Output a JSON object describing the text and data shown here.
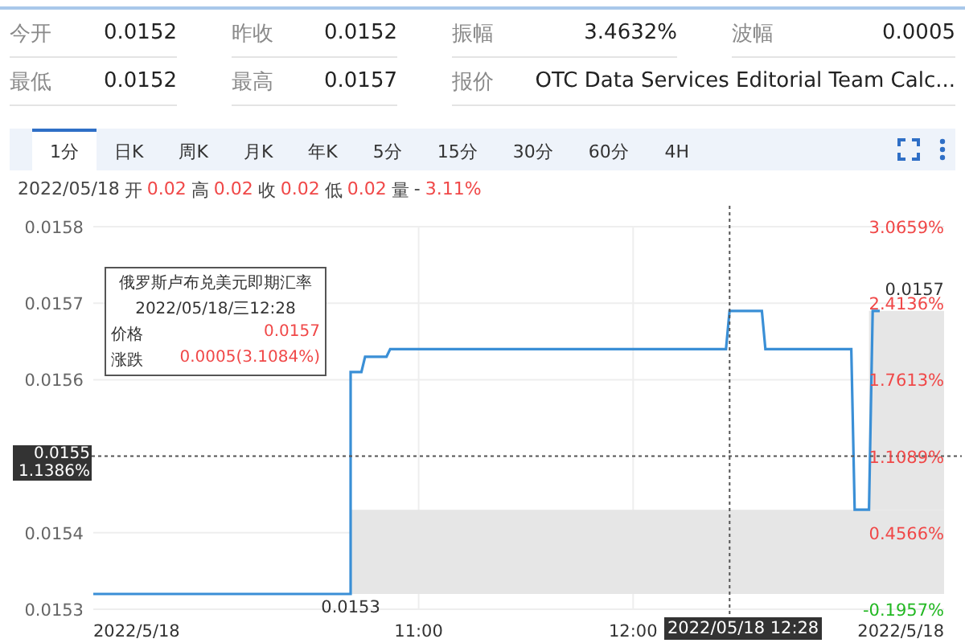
{
  "stats": [
    {
      "label": "今开",
      "value": "0.0152"
    },
    {
      "label": "昨收",
      "value": "0.0152"
    },
    {
      "label": "振幅",
      "value": "3.4632%"
    },
    {
      "label": "波幅",
      "value": "0.0005"
    },
    {
      "label": "最低",
      "value": "0.0152"
    },
    {
      "label": "最高",
      "value": "0.0157"
    },
    {
      "label": "报价",
      "value": "OTC Data Services Editorial Team Calc...",
      "wide": true
    }
  ],
  "tabs": [
    {
      "label": "1分",
      "selected": true
    },
    {
      "label": "日K",
      "selected": false
    },
    {
      "label": "周K",
      "selected": false
    },
    {
      "label": "月K",
      "selected": false
    },
    {
      "label": "年K",
      "selected": false
    },
    {
      "label": "5分",
      "selected": false
    },
    {
      "label": "15分",
      "selected": false
    },
    {
      "label": "30分",
      "selected": false
    },
    {
      "label": "60分",
      "selected": false
    },
    {
      "label": "4H",
      "selected": false
    }
  ],
  "quote_line": {
    "date": "2022/05/18",
    "fields": [
      {
        "label": "开",
        "value": "0.02"
      },
      {
        "label": "高",
        "value": "0.02"
      },
      {
        "label": "收",
        "value": "0.02"
      },
      {
        "label": "低",
        "value": "0.02"
      }
    ],
    "volume_label": "量",
    "volume": "-",
    "change": "3.11%"
  },
  "chart": {
    "chart_data": {
      "type": "line",
      "x": [
        9.483,
        10.683,
        10.683,
        10.733,
        10.75,
        10.85,
        10.867,
        12.433,
        12.45,
        12.6,
        12.617,
        13.017,
        13.033,
        13.1,
        13.117,
        13.15
      ],
      "series": [
        {
          "color": "#3a8fd6",
          "values": [
            0.01532,
            0.01532,
            0.01561,
            0.01561,
            0.01563,
            0.01563,
            0.01564,
            0.01564,
            0.01569,
            0.01569,
            0.01564,
            0.01564,
            0.01543,
            0.01543,
            0.01569,
            0.01569
          ]
        }
      ],
      "xlim": [
        9.483,
        13.45
      ],
      "ylim": [
        0.0153,
        0.0158
      ],
      "xticks": [
        {
          "value": 11,
          "label": "11:00"
        },
        {
          "value": 12,
          "label": "12:00"
        }
      ],
      "yticks": [
        0.0158,
        0.0157,
        0.0156,
        0.0154,
        0.0153
      ],
      "grid": true,
      "ref_lines": [
        {
          "axis": "x",
          "value": 12.45
        },
        {
          "axis": "y",
          "value": 0.0155
        }
      ]
    },
    "ytick_labels": [
      "0.0158",
      "0.0157",
      "0.0156",
      "0.0154",
      "0.0153"
    ],
    "right_ticks": [
      {
        "label": "3.0659%",
        "color": "#f04848"
      },
      {
        "label": "2.4136%",
        "color": "#f04848"
      },
      {
        "label": "1.7613%",
        "color": "#f04848"
      },
      {
        "label": "1.1089%",
        "color": "#f04848"
      },
      {
        "label": "0.4566%",
        "color": "#f04848"
      },
      {
        "label": "-0.1957%",
        "color": "#22b822"
      }
    ],
    "start_date": "2022/5/18",
    "end_date": "2022/5/18",
    "low_label": "0.0153",
    "high_label": "0.0157",
    "crosshair": {
      "price": "0.0155",
      "percent": "1.1386%",
      "time": "2022/05/18 12:28"
    },
    "tooltip": {
      "title": "俄罗斯卢布兑美元即期汇率",
      "datetime": "2022/05/18/三12:28",
      "rows": [
        {
          "label": "价格",
          "value": "0.0157"
        },
        {
          "label": "涨跌",
          "value": "0.0005(3.1084%)"
        }
      ]
    }
  }
}
